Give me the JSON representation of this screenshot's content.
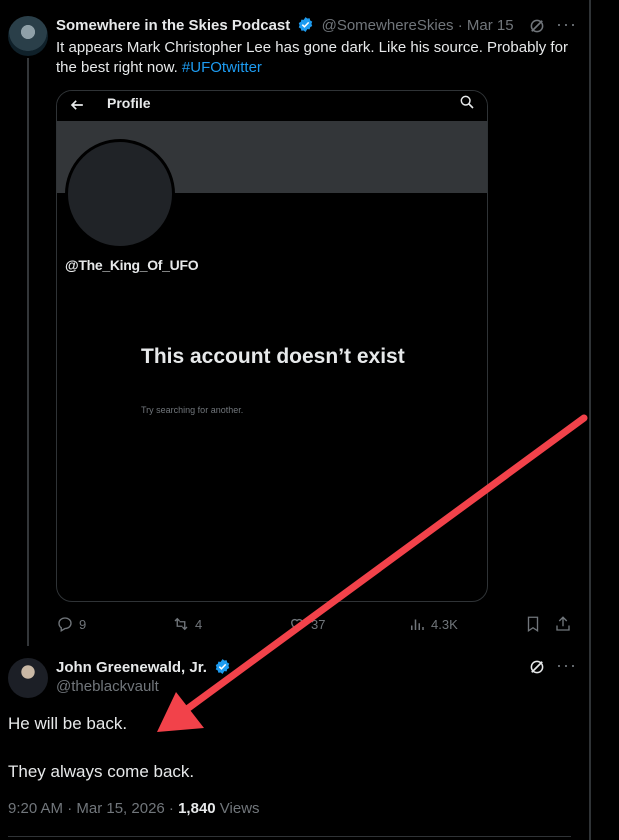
{
  "tweet1": {
    "display_name": "Somewhere in the Skies Podcast",
    "handle": "@SomewhereSkies",
    "separator": "·",
    "date": "Mar 15",
    "text": "It appears Mark Christopher Lee has gone dark. Like his source. Probably for the best right now. ",
    "hashtag": "#UFOtwitter",
    "more_label": "···",
    "media": {
      "header_title": "Profile",
      "handle": "@The_King_Of_UFO",
      "message": "This account doesn’t exist",
      "sub_message": "Try searching for another."
    },
    "actions": {
      "replies": "9",
      "reposts": "4",
      "likes": "37",
      "views": "4.3K"
    }
  },
  "tweet2": {
    "display_name": "John Greenewald, Jr.",
    "handle": "@theblackvault",
    "more_label": "···",
    "lines": [
      "He will be back.",
      "They always come back."
    ],
    "time": "9:20 AM · Mar 15, 2026 · ",
    "views_count": "1,840",
    "views_label": " Views"
  },
  "colors": {
    "background": "#000000",
    "text": "#e7e9ea",
    "muted": "#71767b",
    "accent": "#1d9bf0",
    "annotation_arrow": "#f2424a"
  }
}
